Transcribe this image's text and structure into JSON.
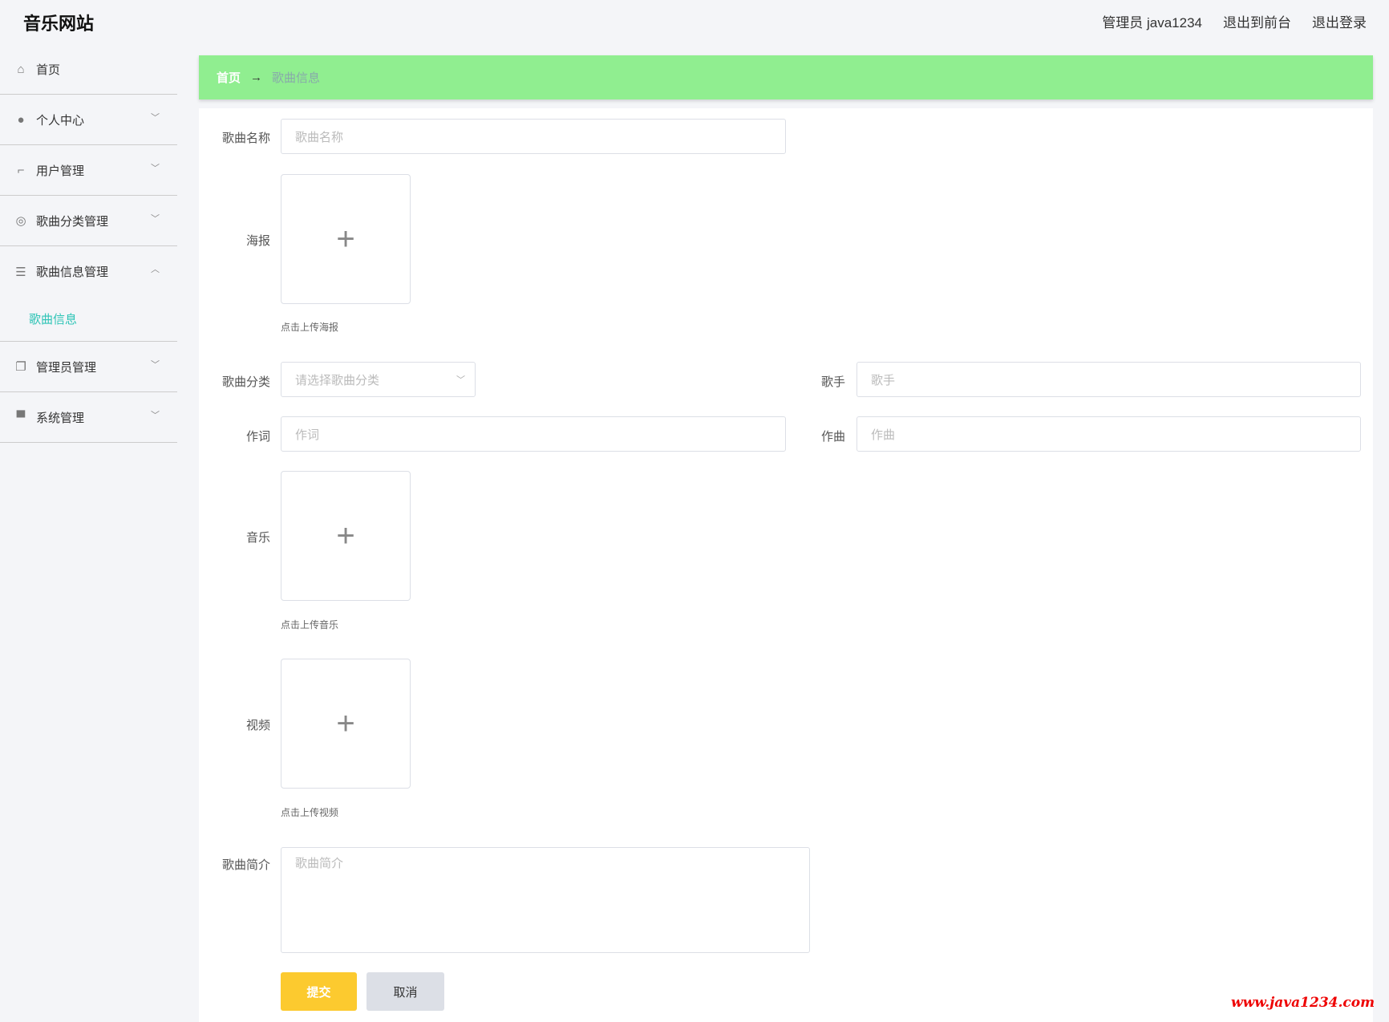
{
  "header": {
    "title": "音乐网站",
    "user": "管理员 java1234",
    "front": "退出到前台",
    "logout": "退出登录"
  },
  "sidebar": {
    "items": [
      {
        "label": "首页",
        "icon": "home-icon"
      },
      {
        "label": "个人中心",
        "icon": "user-icon"
      },
      {
        "label": "用户管理",
        "icon": "crop-icon"
      },
      {
        "label": "歌曲分类管理",
        "icon": "compass-icon"
      },
      {
        "label": "歌曲信息管理",
        "icon": "list-icon"
      },
      {
        "label": "管理员管理",
        "icon": "copy-icon"
      },
      {
        "label": "系统管理",
        "icon": "monitor-icon"
      }
    ],
    "sub": "歌曲信息"
  },
  "breadcrumb": {
    "home": "首页",
    "arrow": "→",
    "current": "歌曲信息"
  },
  "form": {
    "name_label": "歌曲名称",
    "name_ph": "歌曲名称",
    "poster_label": "海报",
    "poster_cap": "点击上传海报",
    "cat_label": "歌曲分类",
    "cat_ph": "请选择歌曲分类",
    "singer_label": "歌手",
    "singer_ph": "歌手",
    "lyric_label": "作词",
    "lyric_ph": "作词",
    "comp_label": "作曲",
    "comp_ph": "作曲",
    "music_label": "音乐",
    "music_cap": "点击上传音乐",
    "video_label": "视频",
    "video_cap": "点击上传视频",
    "desc_label": "歌曲简介",
    "desc_ph": "歌曲简介",
    "submit": "提交",
    "cancel": "取消"
  },
  "watermark": "www.java1234.com",
  "colors": {
    "breadcrumb": "#90ee90",
    "submit": "#fcca2f",
    "active": "#2ec4b6"
  }
}
